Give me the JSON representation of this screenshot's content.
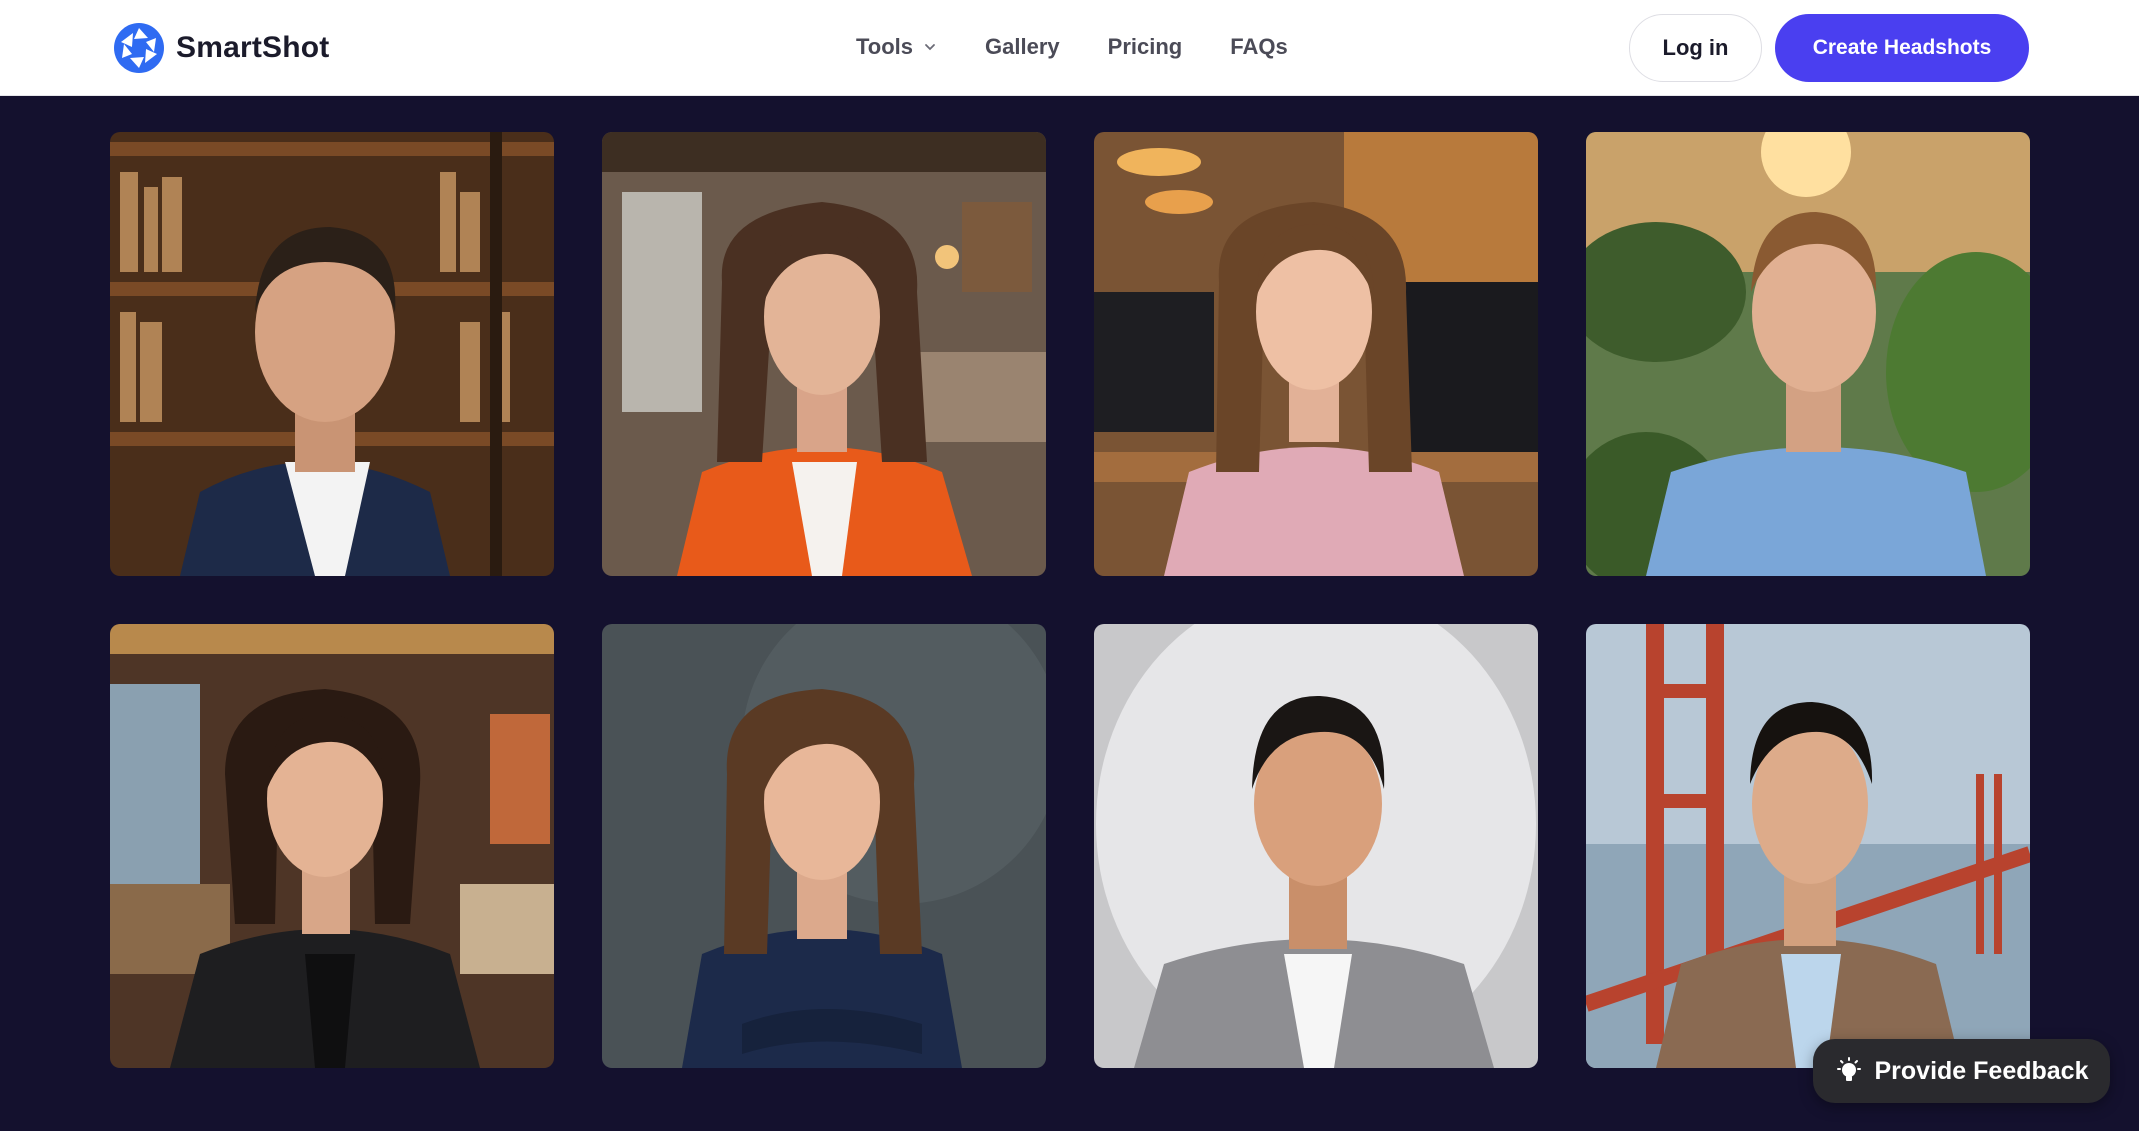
{
  "header": {
    "logo_text": "SmartShot",
    "nav": [
      {
        "label": "Tools",
        "has_dropdown": true
      },
      {
        "label": "Gallery"
      },
      {
        "label": "Pricing"
      },
      {
        "label": "FAQs"
      }
    ],
    "login_label": "Log in",
    "cta_label": "Create Headshots"
  },
  "gallery": {
    "photos": [
      {
        "subject": "man in navy suit, library background"
      },
      {
        "subject": "woman in orange blazer, office lounge"
      },
      {
        "subject": "woman in pink blouse, modern office"
      },
      {
        "subject": "man in light blue shirt, outdoor sunset"
      },
      {
        "subject": "woman in black blazer, lounge interior"
      },
      {
        "subject": "woman in navy blazer, arms crossed, concrete wall"
      },
      {
        "subject": "man in grey suit, studio backdrop"
      },
      {
        "subject": "man in tweed blazer, Golden Gate Bridge"
      }
    ]
  },
  "feedback": {
    "label": "Provide Feedback",
    "icon": "lightbulb-icon"
  },
  "colors": {
    "brand": "#4a3ff0",
    "page_bg": "#14112e",
    "header_bg": "#ffffff",
    "logo_blue": "#2f6bf2"
  }
}
